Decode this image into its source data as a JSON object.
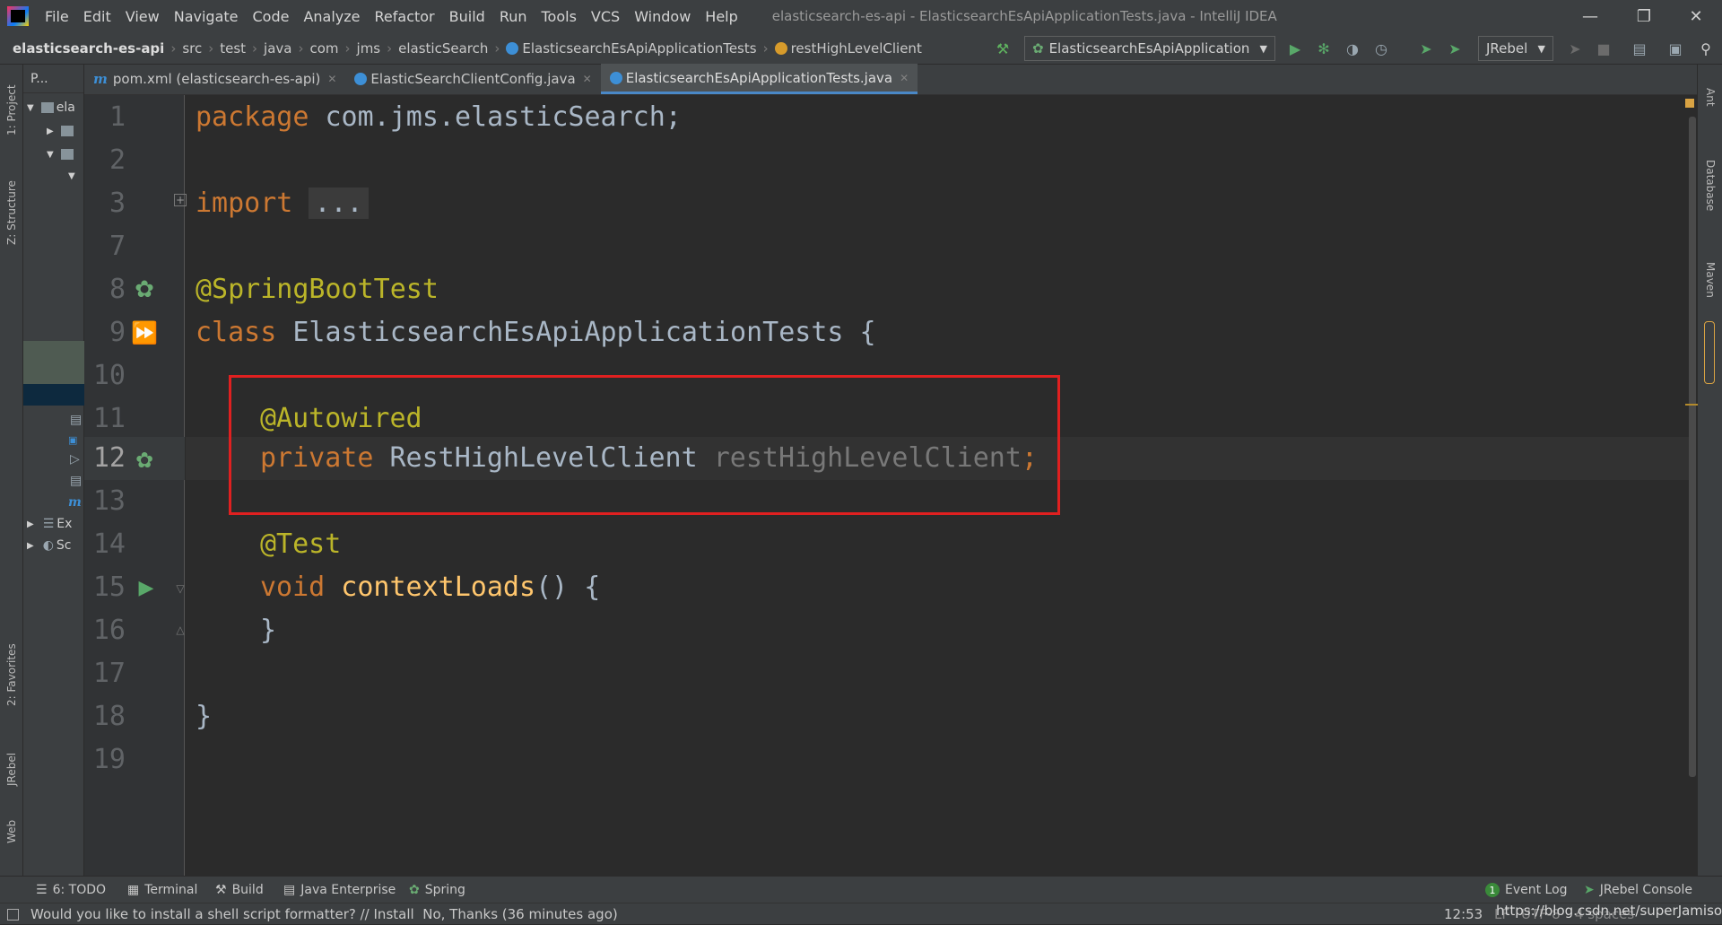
{
  "menu": [
    "File",
    "Edit",
    "View",
    "Navigate",
    "Code",
    "Analyze",
    "Refactor",
    "Build",
    "Run",
    "Tools",
    "VCS",
    "Window",
    "Help"
  ],
  "window_title": "elasticsearch-es-api - ElasticsearchEsApiApplicationTests.java - IntelliJ IDEA",
  "breadcrumb": {
    "project": "elasticsearch-es-api",
    "parts": [
      "src",
      "test",
      "java",
      "com",
      "jms",
      "elasticSearch"
    ],
    "class_name": "ElasticsearchEsApiApplicationTests",
    "member": "restHighLevelClient"
  },
  "toolbar": {
    "run_config": "ElasticsearchEsApiApplication",
    "jrebel_label": "JRebel"
  },
  "left_tabs": {
    "project": "1: Project",
    "structure": "Z: Structure",
    "favorites": "2: Favorites",
    "jrebel": "JRebel",
    "web": "Web"
  },
  "right_tabs": {
    "ant": "Ant",
    "database": "Database",
    "maven": "Maven"
  },
  "project_panel": {
    "header": "P...",
    "root": "ela",
    "ext": "Ex",
    "scratches": "Sc"
  },
  "tabs": [
    {
      "label": "P...",
      "icon": "project-icon"
    },
    {
      "label": "pom.xml (elasticsearch-es-api)",
      "icon": "maven-icon"
    },
    {
      "label": "ElasticSearchClientConfig.java",
      "icon": "class-icon"
    },
    {
      "label": "ElasticsearchEsApiApplicationTests.java",
      "icon": "class-icon",
      "active": true
    }
  ],
  "editor": {
    "line_numbers": [
      "1",
      "2",
      "3",
      "7",
      "8",
      "9",
      "10",
      "11",
      "12",
      "13",
      "14",
      "15",
      "16",
      "17",
      "18",
      "19"
    ],
    "code": {
      "l1_kw": "package",
      "l1_rest": " com.jms.elasticSearch;",
      "l3_kw": "import",
      "l3_fold": "...",
      "l8_ann": "@SpringBootTest",
      "l9_kw": "class",
      "l9_rest": " ElasticsearchEsApiApplicationTests {",
      "l11_ann": "@Autowired",
      "l12_kw": "private",
      "l12_type": " RestHighLevelClient ",
      "l12_field": "restHighLevelClient",
      "l12_semi": ";",
      "l14_ann": "@Test",
      "l15_kw": "void",
      "l15_fn": " contextLoads",
      "l15_rest": "() {",
      "l16": "}",
      "l18": "}"
    }
  },
  "bottom_tools": {
    "todo": "6: TODO",
    "terminal": "Terminal",
    "build": "Build",
    "java_enterprise": "Java Enterprise",
    "spring": "Spring",
    "event_log_count": "1",
    "event_log": "Event Log",
    "jrebel_console": "JRebel Console"
  },
  "status": {
    "message": "Would you like to install a shell script formatter? // Install",
    "message2": "No, Thanks (36 minutes ago)",
    "position": "12:53",
    "line_sep": "LF",
    "encoding": "UTF-8",
    "indent": "4 spaces",
    "watermark": "https://blog.csdn.net/superJamison"
  },
  "colors": {
    "keyword": "#cc7832",
    "annotation": "#bbb529",
    "plain": "#a9b7c6",
    "function": "#ffc66d",
    "unused": "#787878",
    "highlight_box": "#e02020"
  }
}
